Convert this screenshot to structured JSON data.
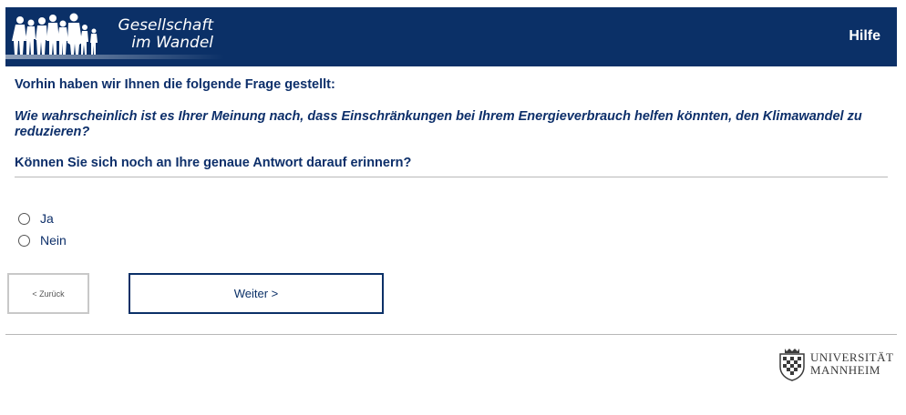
{
  "header": {
    "logo_line1": "Gesellschaft",
    "logo_line2": "im Wandel",
    "help_label": "Hilfe",
    "colors": {
      "background": "#0b3067",
      "text": "#ffffff"
    }
  },
  "main": {
    "intro": "Vorhin haben wir Ihnen die folgende Frage gestellt:",
    "question": "Wie wahrscheinlich ist es Ihrer Meinung nach, dass Einschränkungen bei Ihrem Energieverbrauch helfen könnten, den Klimawandel zu reduzieren?",
    "ask": "Können Sie sich noch an Ihre genaue Antwort darauf erinnern?",
    "options": [
      {
        "label": "Ja",
        "selected": false
      },
      {
        "label": "Nein",
        "selected": false
      }
    ]
  },
  "nav": {
    "back_label": "< Zurück",
    "next_label": "Weiter >"
  },
  "footer": {
    "logo_line1": "UNIVERSITÄT",
    "logo_line2": "MANNHEIM"
  }
}
